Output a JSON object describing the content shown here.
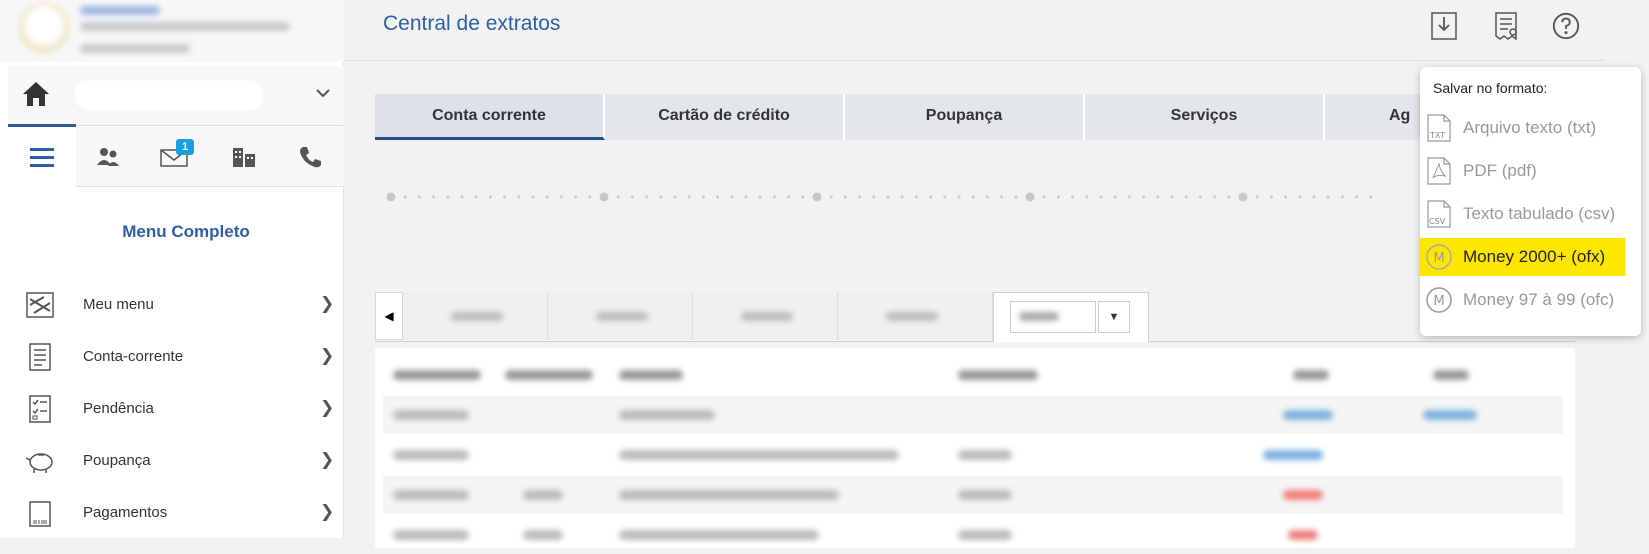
{
  "header": {
    "title": "Central de extratos",
    "icons": [
      "download-icon",
      "receipt-icon",
      "help-icon"
    ]
  },
  "sidebar": {
    "menu_title": "Menu Completo",
    "notification_count": "1",
    "items": [
      {
        "label": "Meu menu",
        "icon": "my-menu-icon"
      },
      {
        "label": "Conta-corrente",
        "icon": "account-icon"
      },
      {
        "label": "Pendência",
        "icon": "checklist-icon"
      },
      {
        "label": "Poupança",
        "icon": "piggy-bank-icon"
      },
      {
        "label": "Pagamentos",
        "icon": "barcode-icon"
      }
    ]
  },
  "tabs": [
    {
      "label": "Conta corrente",
      "active": true
    },
    {
      "label": "Cartão de crédito"
    },
    {
      "label": "Poupança"
    },
    {
      "label": "Serviços"
    },
    {
      "label": "Ag"
    }
  ],
  "save_menu": {
    "caption": "Salvar no formato:",
    "items": [
      {
        "label": "Arquivo texto (txt)",
        "icon": "txt-file-icon"
      },
      {
        "label": "PDF (pdf)",
        "icon": "pdf-file-icon"
      },
      {
        "label": "Texto tabulado (csv)",
        "icon": "csv-file-icon"
      },
      {
        "label": "Money 2000+ (ofx)",
        "icon": "money-icon",
        "highlighted": true
      },
      {
        "label": "Money 97 à 99 (ofc)",
        "icon": "money-icon"
      }
    ]
  },
  "colors": {
    "accent": "#2f5ea8",
    "active_tab_underline": "#1f4f86",
    "highlight": "#ffe600",
    "badge": "#1aa0e0"
  }
}
